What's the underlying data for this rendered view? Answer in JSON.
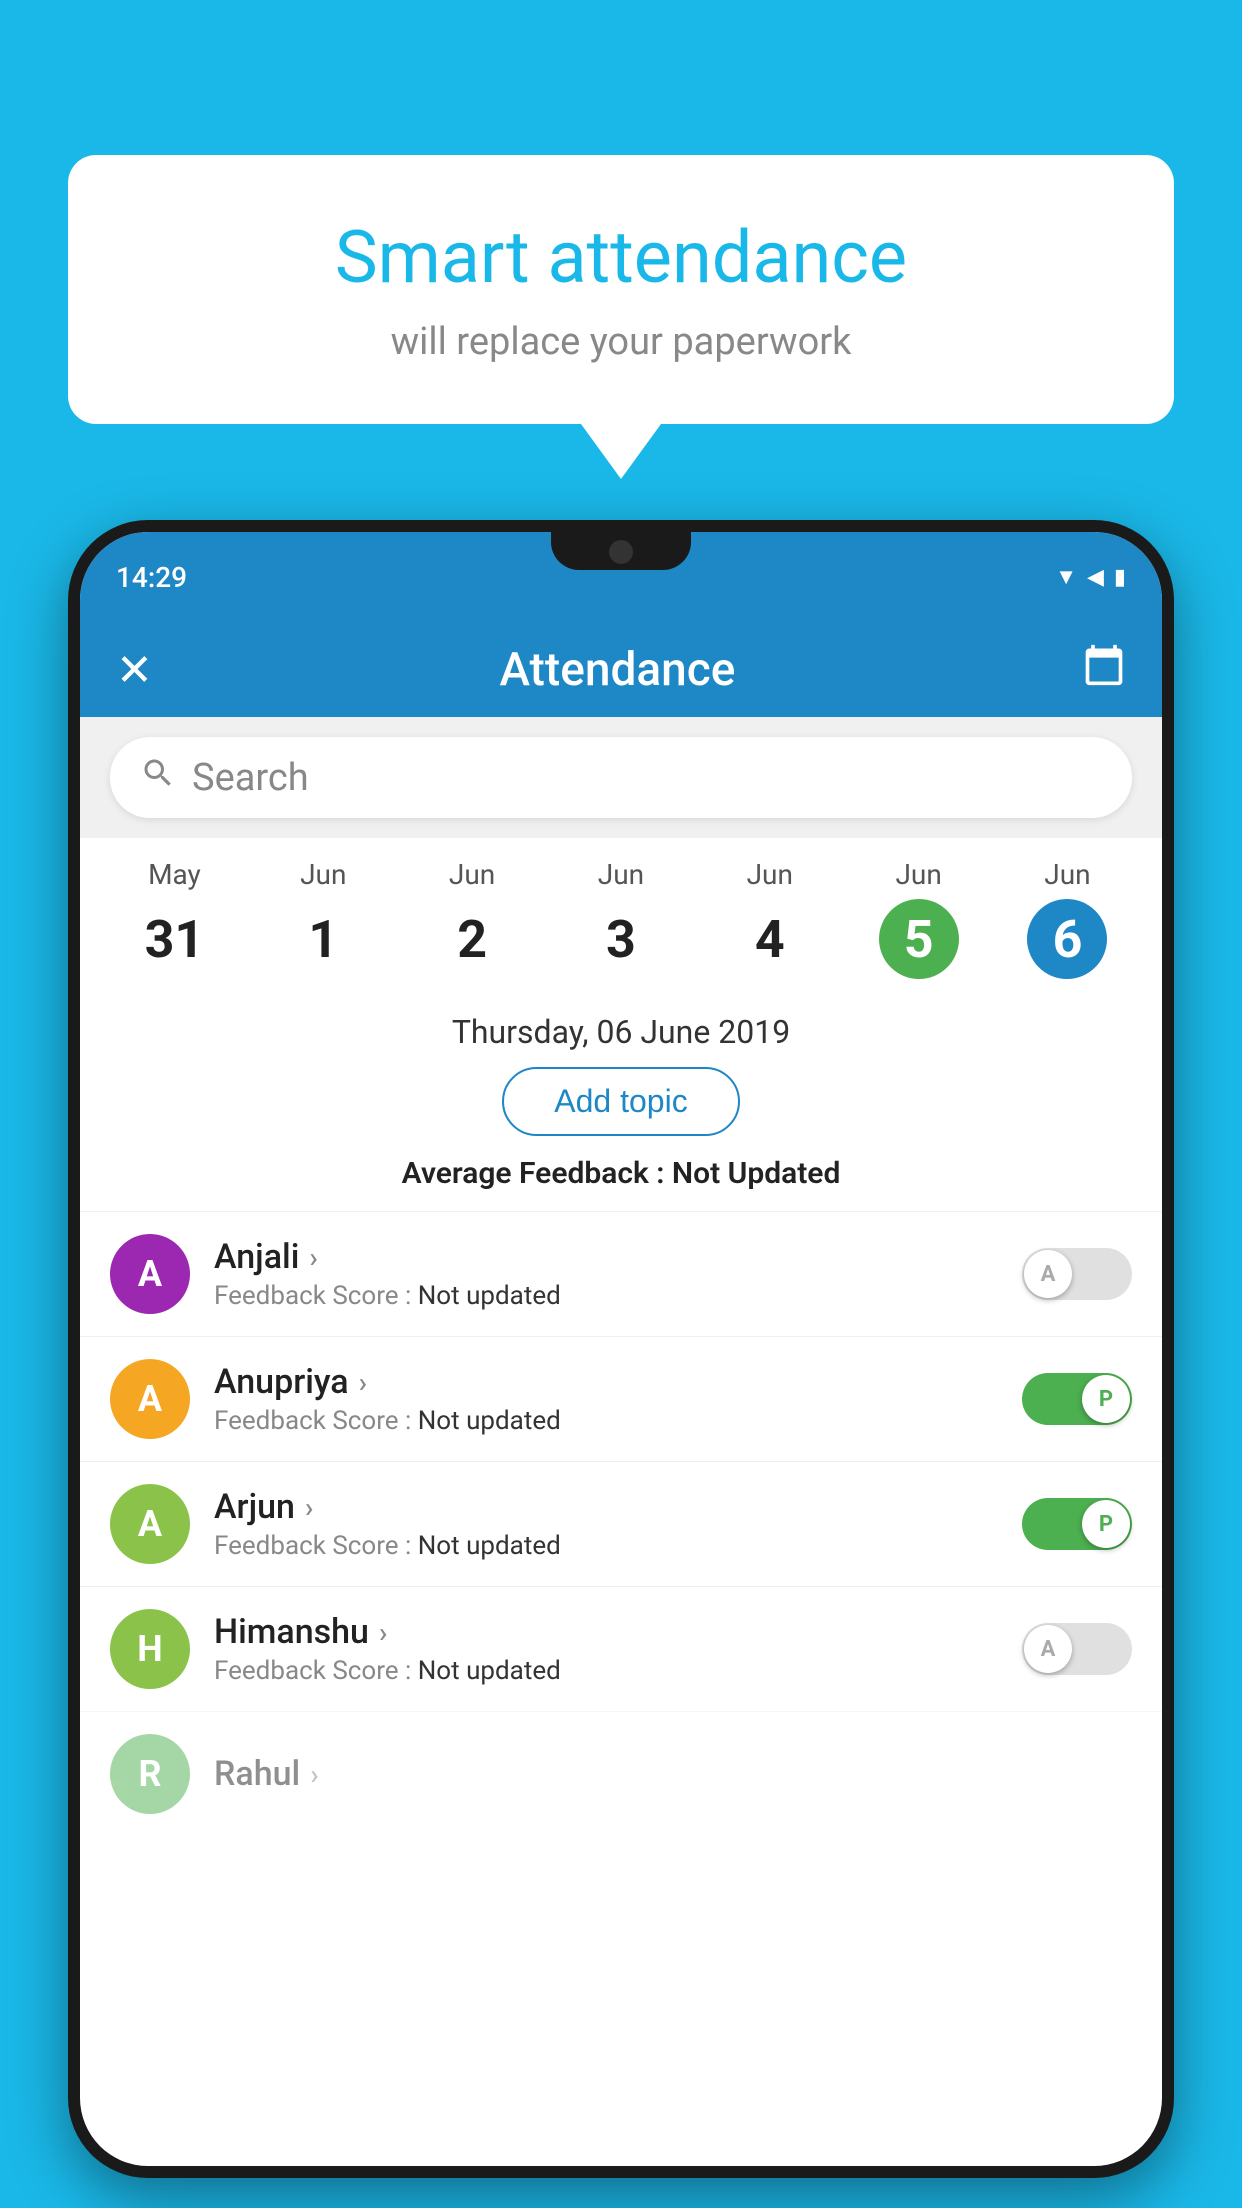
{
  "background_color": "#1ab8e8",
  "speech_bubble": {
    "title": "Smart attendance",
    "subtitle": "will replace your paperwork"
  },
  "status_bar": {
    "time": "14:29",
    "icons": [
      "wifi",
      "signal",
      "battery"
    ]
  },
  "app_header": {
    "title": "Attendance",
    "close_label": "✕",
    "calendar_icon": "📅"
  },
  "search": {
    "placeholder": "Search"
  },
  "dates": [
    {
      "month": "May",
      "day": "31",
      "state": "normal"
    },
    {
      "month": "Jun",
      "day": "1",
      "state": "normal"
    },
    {
      "month": "Jun",
      "day": "2",
      "state": "normal"
    },
    {
      "month": "Jun",
      "day": "3",
      "state": "normal"
    },
    {
      "month": "Jun",
      "day": "4",
      "state": "normal"
    },
    {
      "month": "Jun",
      "day": "5",
      "state": "today"
    },
    {
      "month": "Jun",
      "day": "6",
      "state": "selected"
    }
  ],
  "selected_date_label": "Thursday, 06 June 2019",
  "add_topic_label": "Add topic",
  "avg_feedback_label": "Average Feedback :",
  "avg_feedback_value": "Not Updated",
  "students": [
    {
      "name": "Anjali",
      "feedback_label": "Feedback Score :",
      "feedback_value": "Not updated",
      "avatar_letter": "A",
      "avatar_color": "#9c27b0",
      "attendance": "absent",
      "toggle_letter": "A"
    },
    {
      "name": "Anupriya",
      "feedback_label": "Feedback Score :",
      "feedback_value": "Not updated",
      "avatar_letter": "A",
      "avatar_color": "#f5a623",
      "attendance": "present",
      "toggle_letter": "P"
    },
    {
      "name": "Arjun",
      "feedback_label": "Feedback Score :",
      "feedback_value": "Not updated",
      "avatar_letter": "A",
      "avatar_color": "#8bc34a",
      "attendance": "present",
      "toggle_letter": "P"
    },
    {
      "name": "Himanshu",
      "feedback_label": "Feedback Score :",
      "feedback_value": "Not updated",
      "avatar_letter": "H",
      "avatar_color": "#8bc34a",
      "attendance": "absent",
      "toggle_letter": "A"
    }
  ]
}
